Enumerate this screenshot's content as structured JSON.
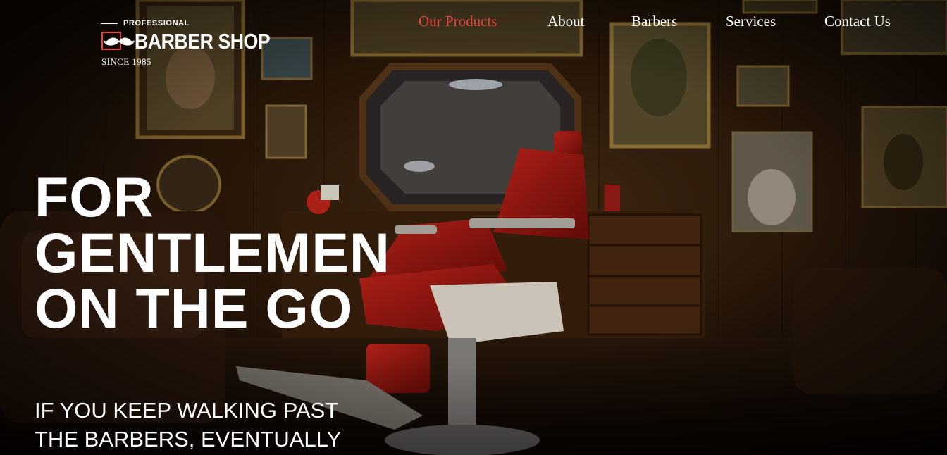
{
  "logo": {
    "tagline": "PROFESSIONAL",
    "name": "BARBER SHOP",
    "since": "SINCE 1985",
    "icon": "mustache-icon"
  },
  "nav": [
    {
      "label": "Our Products",
      "active": true
    },
    {
      "label": "About",
      "active": false
    },
    {
      "label": "Barbers",
      "active": false
    },
    {
      "label": "Services",
      "active": false
    },
    {
      "label": "Contact Us",
      "active": false
    }
  ],
  "hero": {
    "headline": [
      "FOR",
      "GENTLEMEN",
      "ON THE GO"
    ],
    "subheadline": [
      "IF YOU KEEP WALKING PAST",
      "THE BARBERS, EVENTUALLY"
    ]
  },
  "colors": {
    "accent": "#e8453c",
    "text": "#ffffff",
    "background": "#2a1809"
  }
}
